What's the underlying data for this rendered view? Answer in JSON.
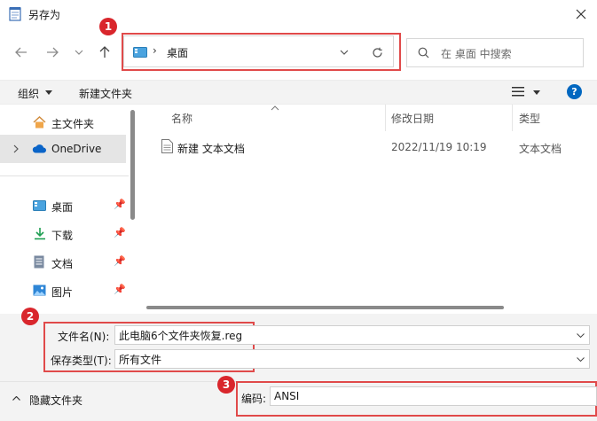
{
  "window": {
    "title": "另存为"
  },
  "address": {
    "current": "桌面",
    "badge": "1"
  },
  "search": {
    "placeholder": "在 桌面 中搜索"
  },
  "toolbar": {
    "organize": "组织",
    "new_folder": "新建文件夹"
  },
  "sidebar": {
    "items": [
      {
        "label": "主文件夹",
        "icon": "home-icon"
      },
      {
        "label": "OneDrive",
        "icon": "cloud-icon"
      },
      {
        "label": "桌面",
        "icon": "desktop-icon"
      },
      {
        "label": "下载",
        "icon": "download-icon"
      },
      {
        "label": "文档",
        "icon": "document-icon"
      },
      {
        "label": "图片",
        "icon": "picture-icon"
      }
    ]
  },
  "columns": {
    "name": "名称",
    "modified": "修改日期",
    "type": "类型"
  },
  "files": [
    {
      "name": "新建 文本文档",
      "modified": "2022/11/19 10:19",
      "type": "文本文档"
    }
  ],
  "form": {
    "filename_label": "文件名(N):",
    "filename_value": "此电脑6个文件夹恢复.reg",
    "filetype_label": "保存类型(T):",
    "filetype_value": "所有文件",
    "badge": "2"
  },
  "encoding": {
    "label": "编码:",
    "value": "ANSI",
    "badge": "3"
  },
  "hide_folders": {
    "label": "隐藏文件夹"
  },
  "colors": {
    "accent": "#0067c0",
    "highlight": "#e04a4a",
    "badge": "#d9262c"
  }
}
